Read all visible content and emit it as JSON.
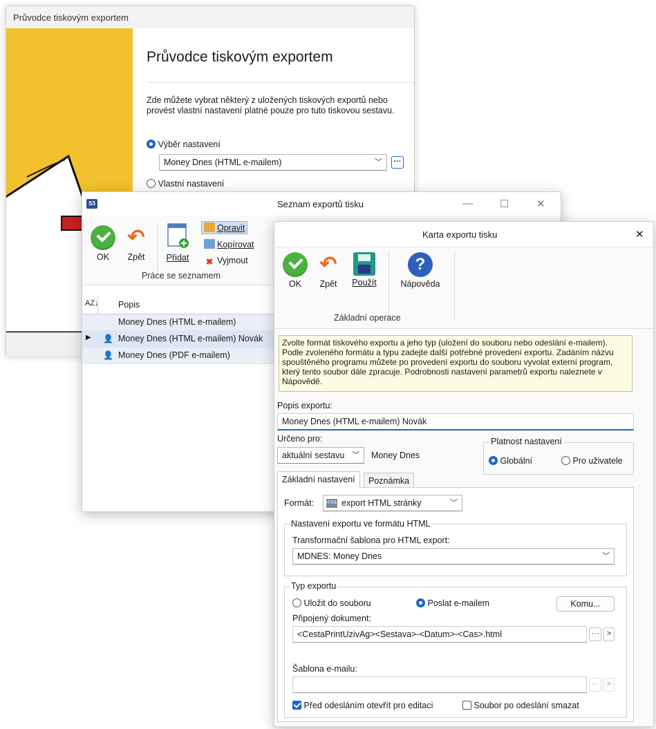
{
  "wizard": {
    "window_title": "Průvodce tiskovým exportem",
    "heading": "Průvodce tiskovým exportem",
    "description": "Zde můžete vybrat některý z uložených tiskových exportů nebo provést vlastní nastavení platné pouze pro tuto tiskovou sestavu.",
    "option_select": "Výběr nastavení",
    "selected_export": "Money Dnes (HTML e-mailem)",
    "option_custom": "Vlastní nastavení",
    "more_button": "···"
  },
  "list_window": {
    "title": "Seznam exportů tisku",
    "logo": "S3",
    "ribbon": {
      "ok": "OK",
      "back": "Zpět",
      "add": "Přidat",
      "edit": "Opravit",
      "copy": "Kopírovat",
      "cut": "Vyjmout",
      "group_label": "Práce se seznamem"
    },
    "column_header": "Popis",
    "sort_icon": "AZ↓",
    "rows": [
      {
        "text": "Money Dnes (HTML e-mailem)",
        "user": false,
        "current": false
      },
      {
        "text": "Money Dnes (HTML e-mailem) Novák",
        "user": true,
        "current": true
      },
      {
        "text": "Money Dnes (PDF e-mailem)",
        "user": true,
        "current": false
      }
    ]
  },
  "karta": {
    "title": "Karta exportu tisku",
    "close": "✕",
    "ribbon": {
      "ok": "OK",
      "back": "Zpět",
      "apply": "Použít",
      "help": "Nápověda",
      "group_label": "Základní operace"
    },
    "info_text": "Zvolte formát tiskového exportu a jeho typ (uložení do souboru nebo odeslání e-mailem). Podle zvoleného formátu a typu zadejte další potřebné provedení exportu. Zadáním názvu spouštěného programu můžete po provedení exportu do souboru vyvolat externí program, který tento soubor dále zpracuje. Podrobnosti nastavení parametrů exportu naleznete v Nápovědě.",
    "description_label": "Popis exportu:",
    "description_value": "Money Dnes (HTML e-mailem) Novák",
    "intended_label": "Určeno pro:",
    "intended_value": "aktuální sestavu",
    "intended_name": "Money Dnes",
    "validity_label": "Platnost nastavení",
    "validity_global": "Globální",
    "validity_user": "Pro uživatele",
    "tabs": [
      "Základní nastavení",
      "Poznámka"
    ],
    "format_label": "Formát:",
    "format_value": "export HTML stránky",
    "html_group": "Nastavení exportu ve formátu HTML",
    "template_label": "Transformační šablona pro HTML export:",
    "template_value": "MDNES: Money Dnes",
    "type_group": "Typ exportu",
    "type_file": "Uložit do souboru",
    "type_email": "Poslat e-mailem",
    "to_button": "Komu...",
    "attached_label": "Připojený dokument:",
    "attached_value": "<CestaPrintUzivAg><Sestava>-<Datum>-<Cas>.html",
    "email_template_label": "Šablona e-mailu:",
    "email_template_value": "",
    "check_open": "Před odesláním otevřít pro editaci",
    "check_delete": "Soubor po odeslání smazat",
    "dots": "···",
    "arrow": ">"
  },
  "colors": {
    "accent": "#1e66c8",
    "wizard_yellow": "#f2c12e",
    "ok_green": "#4cb13f",
    "back_orange": "#ea6a1f",
    "info_bg": "#fdfbe1"
  }
}
